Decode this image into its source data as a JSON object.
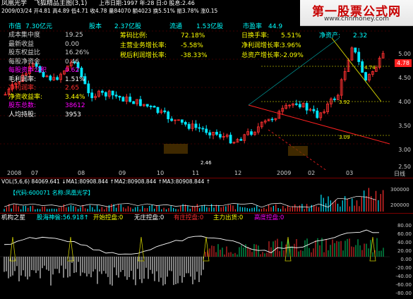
{
  "colors": {
    "up": "#ff3030",
    "down": "#00e6ff",
    "bg": "#000000",
    "grid": "#7a0000",
    "yellow": "#ffff00",
    "cyan": "#00ffff",
    "magenta": "#ff00ff",
    "green": "#00ff00"
  },
  "header": {
    "stock_name": "凤凰光学",
    "title": "飞狐精品主图(3,1)",
    "market_tab": "上市日期:1997 年:28 日:0 股息:2.46",
    "row2": "2009/03/24 开4.81 高4.89 低4.71 收4.78 量84070 额4023 换5.51% 振3.78% 涨0.15"
  },
  "watermark": {
    "title": "第一股票公式网",
    "url": "www.chnmoney.com"
  },
  "info_top": {
    "shizhi": "市值",
    "shizhi_val": "7.30亿元",
    "guben": "股本",
    "guben_val": "2.37亿股",
    "liutong": "流通",
    "liutong_val": "1.53亿股",
    "shiying": "市盈率",
    "shiying_val": "44.9"
  },
  "info_left": [
    {
      "label": "成本集中度",
      "value": "19.25",
      "color": "#cccccc"
    },
    {
      "label": "最新收益",
      "value": "0.00",
      "color": "#cccccc"
    },
    {
      "label": "股东权益比",
      "value": "16.26%",
      "color": "#cccccc"
    },
    {
      "label": "每股净资金",
      "value": "0.46",
      "color": "#cccccc"
    },
    {
      "label": "每股资本公积",
      "value": "0.62",
      "color": "#ff00ff"
    },
    {
      "label": "毛利润率:",
      "value": "1.51%",
      "color": "#ffffff"
    },
    {
      "label": "净利润率:",
      "value": "2.65",
      "color": "#ff3030"
    },
    {
      "label": "净资收益率:",
      "value": "3.44%",
      "color": "#ffff00"
    },
    {
      "label": "股东总数:",
      "value": "38612",
      "color": "#ff00ff"
    },
    {
      "label": "人均持股:",
      "value": "3953",
      "color": "#ffffff"
    }
  ],
  "info_mid": [
    {
      "label": "筹码比例:",
      "value": "72.18%"
    },
    {
      "label": "主营业务增长率:",
      "value": "-5.58%"
    },
    {
      "label": "税后利润增长率:",
      "value": "-38.33%"
    }
  ],
  "info_right": [
    {
      "label": "日换手率:",
      "value": "5.51%"
    },
    {
      "label": "净利润增长率:",
      "value": "3.96%"
    },
    {
      "label": "总资产增长率:",
      "value": "-2.09%"
    }
  ],
  "info_right_extra": {
    "label": "净资产:",
    "value": "2.32"
  },
  "price_axis": [
    "5.00",
    "4.50",
    "4.00",
    "3.50",
    "3.00",
    "2.50"
  ],
  "last_price": "4.78",
  "chart_annotations": {
    "low": "2.46",
    "level1": "3.92",
    "level2": "3.09",
    "level3": "4.74"
  },
  "date_axis": [
    "2008",
    "07",
    "08",
    "09",
    "10",
    "11",
    "12",
    "2009",
    "02",
    "03"
  ],
  "date_axis_right": "日线",
  "vol_header": "VOL(5,6,6)  84069.641 ↓MA1:80908.844 ↑MA2:80908.844 ↑MA3:80908.844 ↑",
  "vol_axis": [
    "300000",
    "200000"
  ],
  "code_row": "【代码:600071 名称:凤凰光学】",
  "indicator_header": {
    "name": "机构之星",
    "p1": "股海神偷:56.918↑",
    "p2": "开始控盘:0",
    "p3": "无庄控盘:0",
    "p4": "有庄控盘:0",
    "p5": "主力出货:0",
    "p6": "高度控盘:0"
  },
  "ind_axis": [
    "80.00",
    "60.00",
    "40.00",
    "20.00",
    "0.00",
    "-20.00",
    "-40.00",
    "-60.00",
    "-80.00"
  ]
}
